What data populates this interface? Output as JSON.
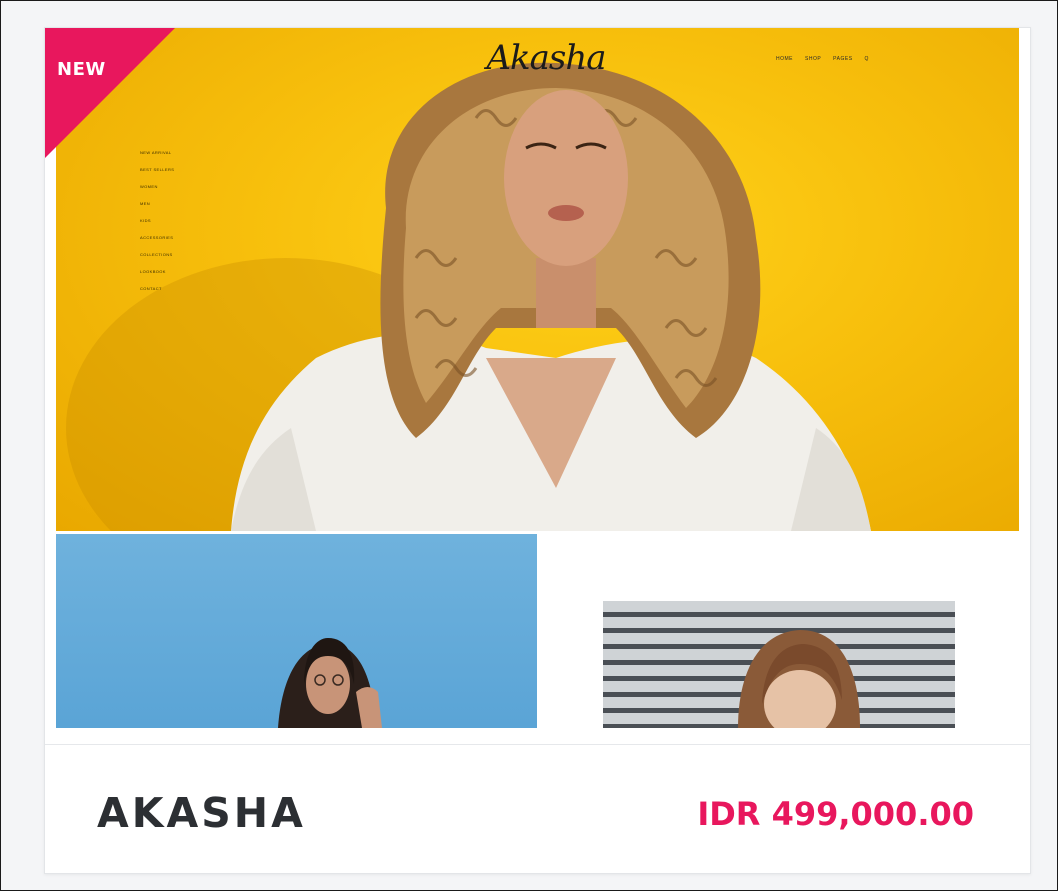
{
  "card": {
    "badge": "NEW",
    "product_name": "AKASHA",
    "price": "IDR 499,000.00"
  },
  "preview": {
    "logo": "Akasha",
    "top_nav": [
      "HOME",
      "SHOP",
      "PAGES",
      "Q"
    ],
    "side_menu": [
      "NEW ARRIVAL",
      "BEST SELLERS",
      "WOMEN",
      "MEN",
      "KIDS",
      "ACCESSORIES",
      "COLLECTIONS",
      "LOOKBOOK",
      "CONTACT"
    ]
  },
  "colors": {
    "accent": "#e8175d",
    "hero_bg": "#f7bf0c",
    "tile_blue": "#5aa4d6",
    "text_dark": "#2c2f33"
  }
}
